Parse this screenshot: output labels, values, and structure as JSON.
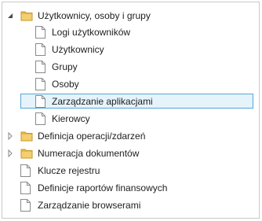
{
  "tree": {
    "items": [
      {
        "label": "Użytkownicy, osoby i grupy",
        "type": "folder",
        "expanded": true,
        "selected": false
      },
      {
        "label": "Logi użytkowników",
        "type": "document",
        "selected": false
      },
      {
        "label": "Użytkownicy",
        "type": "document",
        "selected": false
      },
      {
        "label": "Grupy",
        "type": "document",
        "selected": false
      },
      {
        "label": "Osoby",
        "type": "document",
        "selected": false
      },
      {
        "label": "Zarządzanie aplikacjami",
        "type": "document",
        "selected": true
      },
      {
        "label": "Kierowcy",
        "type": "document",
        "selected": false
      },
      {
        "label": "Definicja operacji/zdarzeń",
        "type": "folder",
        "expanded": false,
        "selected": false
      },
      {
        "label": "Numeracja dokumentów",
        "type": "folder",
        "expanded": false,
        "selected": false
      },
      {
        "label": "Klucze rejestru",
        "type": "document",
        "selected": false
      },
      {
        "label": "Definicje raportów finansowych",
        "type": "document",
        "selected": false
      },
      {
        "label": "Zarządzanie browserami",
        "type": "document",
        "selected": false
      }
    ]
  },
  "colors": {
    "selection_bg": "#e5f3fb",
    "selection_border": "#56a6d3",
    "folder": "#e8b84a"
  }
}
